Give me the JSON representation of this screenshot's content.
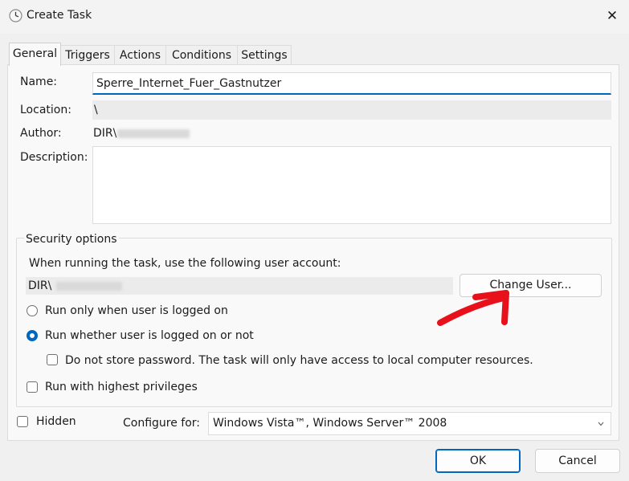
{
  "window": {
    "title": "Create Task",
    "close_glyph": "✕"
  },
  "tabs": [
    {
      "label": "General",
      "active": true
    },
    {
      "label": "Triggers"
    },
    {
      "label": "Actions"
    },
    {
      "label": "Conditions"
    },
    {
      "label": "Settings"
    }
  ],
  "general": {
    "name_label": "Name:",
    "name_value": "Sperre_Internet_Fuer_Gastnutzer",
    "location_label": "Location:",
    "location_value": "\\",
    "author_label": "Author:",
    "author_value": "DIR\\",
    "description_label": "Description:",
    "description_value": ""
  },
  "security": {
    "group_title": "Security options",
    "account_prompt": "When running the task, use the following user account:",
    "account_value": "DIR\\",
    "change_user_label": "Change User...",
    "run_logged_on_label": "Run only when user is logged on",
    "run_whether_label": "Run whether user is logged on or not",
    "selected_run_mode": "run_whether",
    "no_store_password_label": "Do not store password.  The task will only have access to local computer resources.",
    "no_store_password_checked": false,
    "highest_privileges_label": "Run with highest privileges",
    "highest_privileges_checked": false
  },
  "bottom": {
    "hidden_label": "Hidden",
    "hidden_checked": false,
    "configure_label": "Configure for:",
    "configure_value": "Windows Vista™, Windows Server™ 2008",
    "ok_label": "OK",
    "cancel_label": "Cancel"
  },
  "colors": {
    "accent": "#0067c0",
    "annotation": "#e8101a",
    "background": "#f0f0f0"
  }
}
